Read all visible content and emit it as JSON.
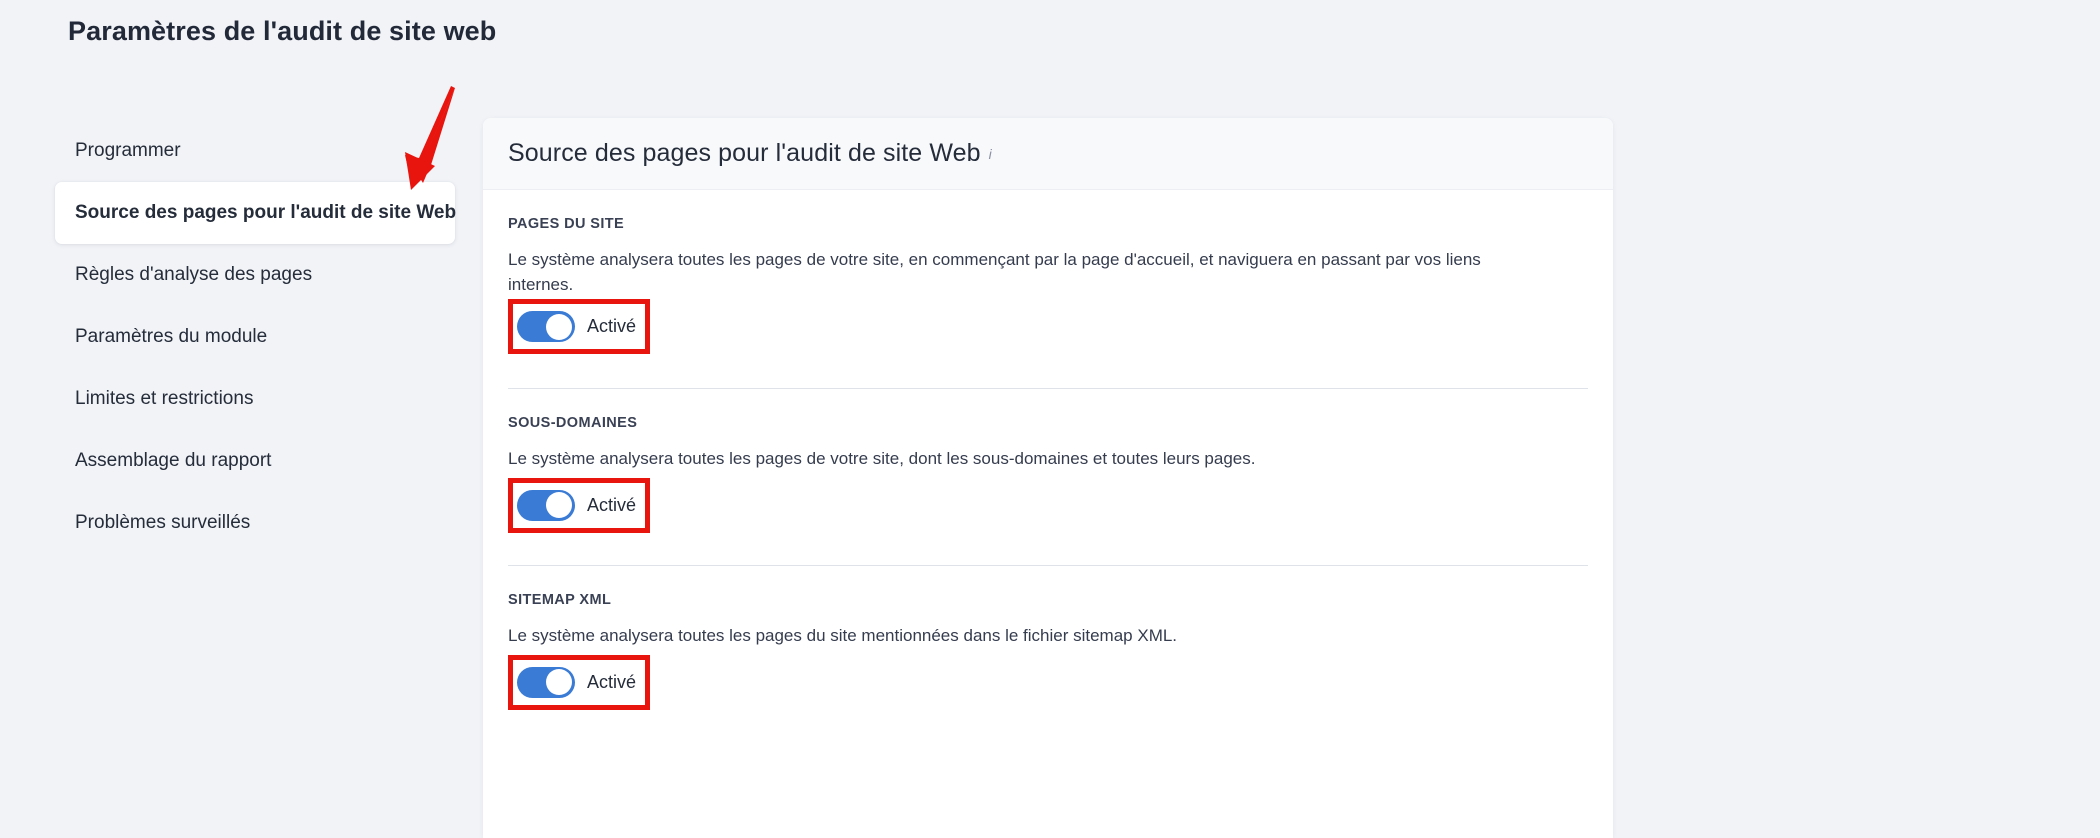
{
  "page": {
    "title": "Paramètres de l'audit de site web",
    "background_color": "#f1f3f7"
  },
  "sidebar": {
    "items": [
      {
        "label": "Programmer",
        "active": false
      },
      {
        "label": "Source des pages pour l'audit de site Web",
        "active": true
      },
      {
        "label": "Règles d'analyse des pages",
        "active": false
      },
      {
        "label": "Paramètres du module",
        "active": false
      },
      {
        "label": "Limites et restrictions",
        "active": false
      },
      {
        "label": "Assemblage du rapport",
        "active": false
      },
      {
        "label": "Problèmes surveillés",
        "active": false
      }
    ]
  },
  "panel": {
    "title": "Source des pages pour l'audit de site Web",
    "info_icon": "i",
    "sections": [
      {
        "label": "PAGES DU SITE",
        "description": "Le système analysera toutes les pages de votre site, en commençant par la page d'accueil, et naviguera en passant par vos liens internes.",
        "toggle_label": "Activé",
        "toggle_state": "on"
      },
      {
        "label": "SOUS-DOMAINES",
        "description": "Le système analysera toutes les pages de votre site, dont les sous-domaines et toutes leurs pages.",
        "toggle_label": "Activé",
        "toggle_state": "on"
      },
      {
        "label": "SITEMAP XML",
        "description": "Le système analysera toutes les pages du site mentionnées dans le fichier sitemap XML.",
        "toggle_label": "Activé",
        "toggle_state": "on"
      }
    ]
  },
  "annotations": {
    "arrow_color": "#e8150f",
    "box_color": "#e8150f"
  },
  "colors": {
    "toggle_on": "#3a7bd5",
    "panel_background": "#ffffff",
    "panel_header_background": "#f8f9fb",
    "text_primary": "#252c3a"
  }
}
